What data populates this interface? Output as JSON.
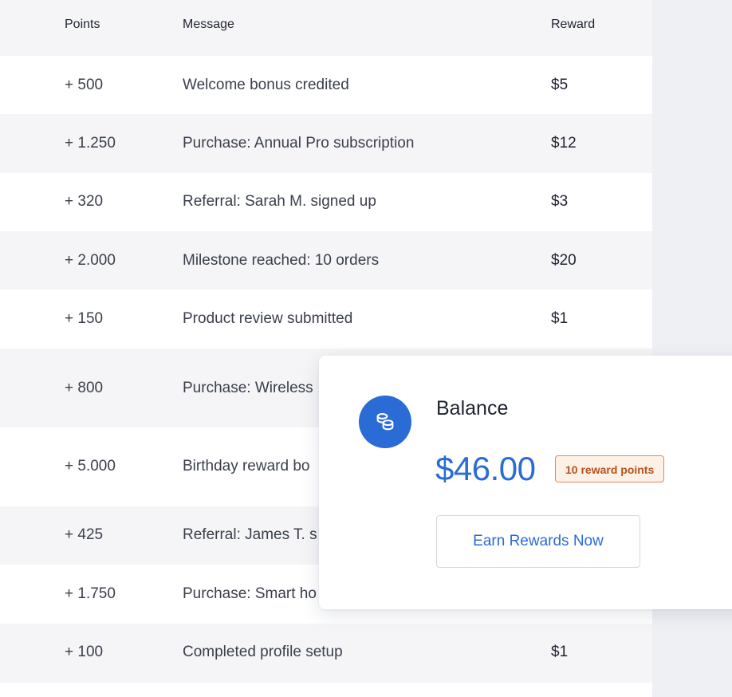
{
  "table": {
    "headers": {
      "points": "Points",
      "message": "Message",
      "reward": "Reward"
    },
    "rows": [
      {
        "points": "+ 500",
        "message": "Welcome bonus credited",
        "reward": "$5"
      },
      {
        "points": "+ 1.250",
        "message": "Purchase: Annual Pro subscription",
        "reward": "$12"
      },
      {
        "points": "+ 320",
        "message": "Referral: Sarah M. signed up",
        "reward": "$3"
      },
      {
        "points": "+ 2.000",
        "message": "Milestone reached: 10 orders",
        "reward": "$20"
      },
      {
        "points": "+ 150",
        "message": "Product review submitted",
        "reward": "$1"
      },
      {
        "points": "+ 800",
        "message": "Purchase: Wireless",
        "reward": ""
      },
      {
        "points": "+ 5.000",
        "message": "Birthday reward bo",
        "reward": ""
      },
      {
        "points": "+ 425",
        "message": "Referral: James T. s",
        "reward": ""
      },
      {
        "points": "+ 1.750",
        "message": "Purchase: Smart ho",
        "reward": ""
      },
      {
        "points": "+ 100",
        "message": "Completed profile setup",
        "reward": "$1"
      }
    ]
  },
  "balance_card": {
    "icon": "coins-icon",
    "label": "Balance",
    "amount": "$46.00",
    "badge": "10 reward points",
    "button_label": "Earn Rewards Now"
  },
  "colors": {
    "accent": "#2b6bd6",
    "badge_text": "#b5521a",
    "badge_border": "#e08a52",
    "badge_bg": "#fdf1e7"
  }
}
